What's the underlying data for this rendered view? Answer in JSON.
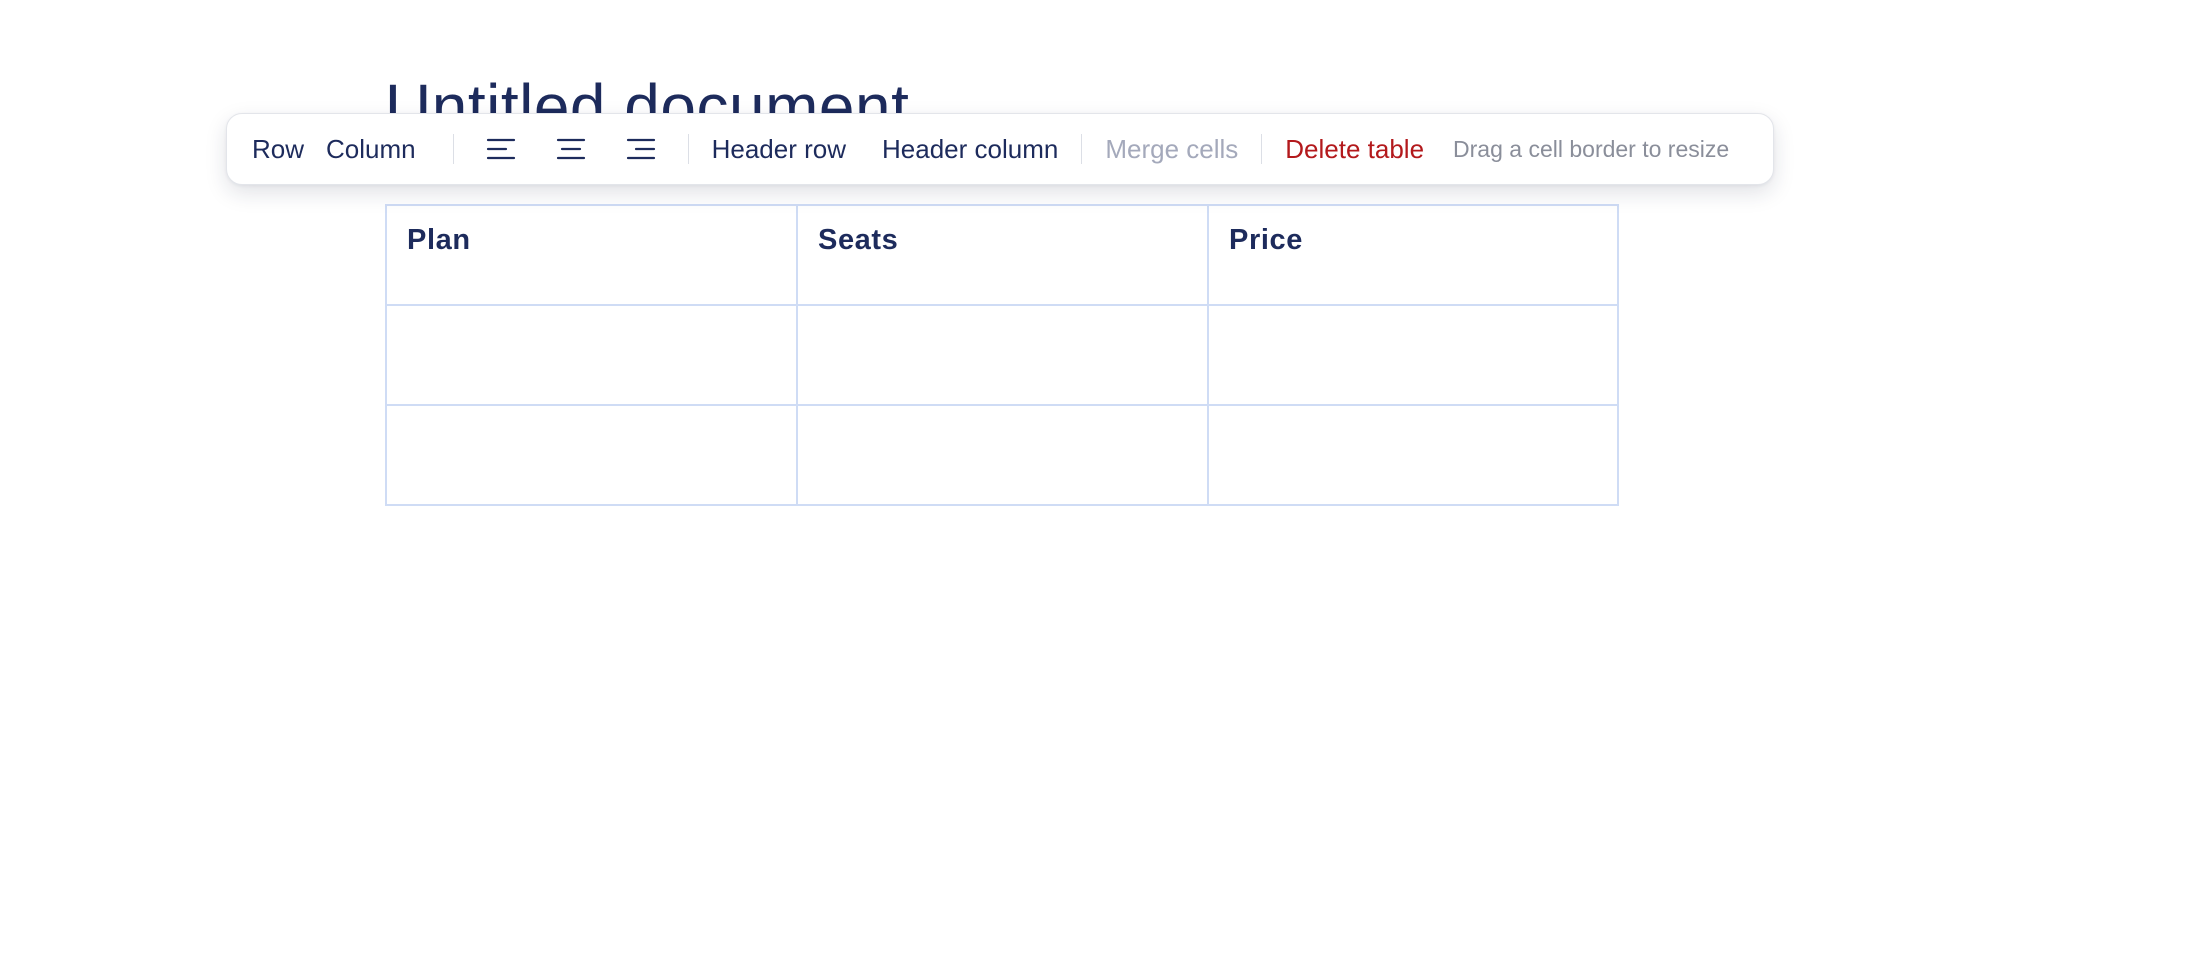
{
  "document": {
    "title": "Untitled document"
  },
  "toolbar": {
    "row_label": "Row",
    "column_label": "Column",
    "align_left_icon": "align-left-icon",
    "align_center_icon": "align-center-icon",
    "align_right_icon": "align-right-icon",
    "header_row_label": "Header row",
    "header_column_label": "Header column",
    "merge_cells_label": "Merge cells",
    "delete_table_label": "Delete table",
    "hint": "Drag a cell border to resize"
  },
  "table": {
    "headers": [
      "Plan",
      "Seats",
      "Price"
    ],
    "rows": [
      [
        "",
        "",
        ""
      ],
      [
        "",
        "",
        ""
      ]
    ]
  },
  "colors": {
    "text": "#1d2b5c",
    "danger": "#b3191c",
    "disabled": "#a4a9bb",
    "table_border": "#cfdcf5"
  }
}
